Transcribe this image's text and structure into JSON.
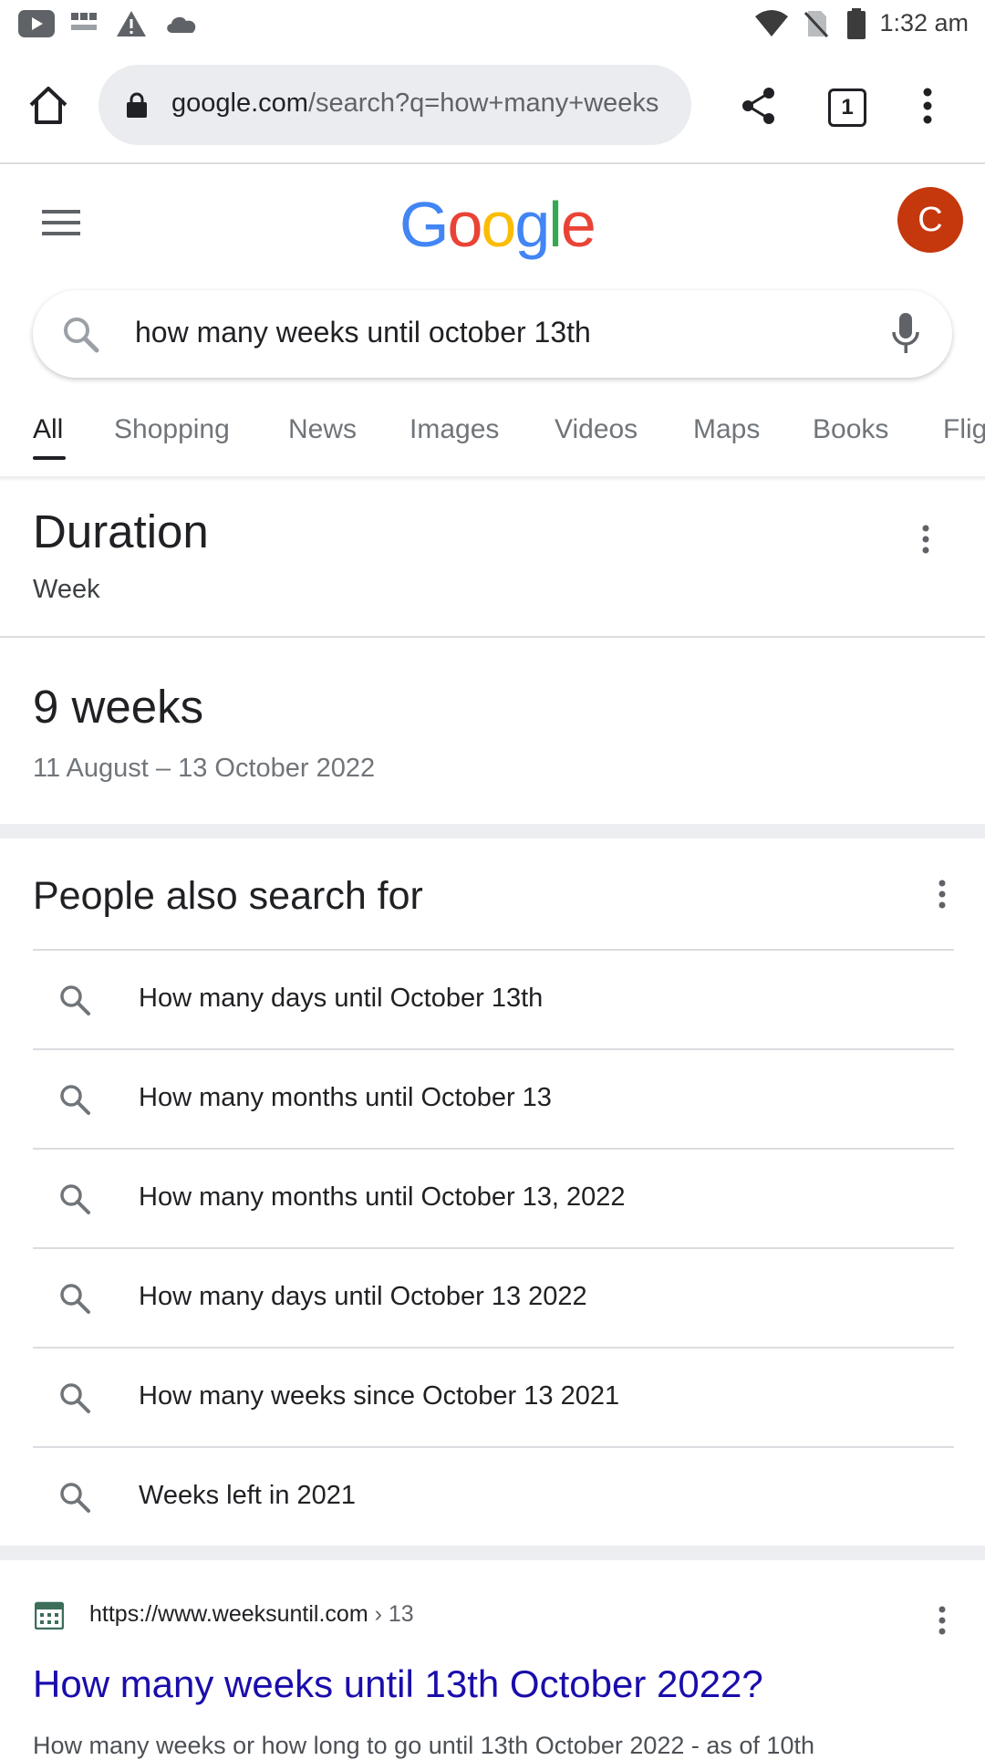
{
  "status_bar": {
    "time": "1:32 am"
  },
  "browser": {
    "url_domain": "google.com",
    "url_path": "/search?q=how+many+weeks",
    "tab_count": "1"
  },
  "google": {
    "logo": "Google",
    "avatar_initial": "C",
    "query": "how many weeks until october 13th",
    "tabs": [
      {
        "label": "All"
      },
      {
        "label": "Shopping"
      },
      {
        "label": "News"
      },
      {
        "label": "Images"
      },
      {
        "label": "Videos"
      },
      {
        "label": "Maps"
      },
      {
        "label": "Books"
      },
      {
        "label": "Flig"
      }
    ]
  },
  "answer": {
    "heading": "Duration",
    "unit": "Week",
    "value": "9 weeks",
    "range": "11 August – 13 October 2022"
  },
  "people_also_search": {
    "title": "People also search for",
    "items": [
      "How many days until October 13th",
      "How many months until October 13",
      "How many months until October 13, 2022",
      "How many days until October 13 2022",
      "How many weeks since October 13 2021",
      "Weeks left in 2021"
    ]
  },
  "result": {
    "url": "https://www.weeksuntil.com",
    "crumb": "› 13",
    "title": "How many weeks until 13th October 2022?",
    "snippet": "How many weeks or how long to go until 13th October 2022 - as of 10th"
  },
  "colors": {
    "link": "#1a0dab",
    "avatar": "#c5380d",
    "google_blue": "#4285f4",
    "google_red": "#ea4335",
    "google_yellow": "#fbbc05",
    "google_green": "#34a853"
  }
}
